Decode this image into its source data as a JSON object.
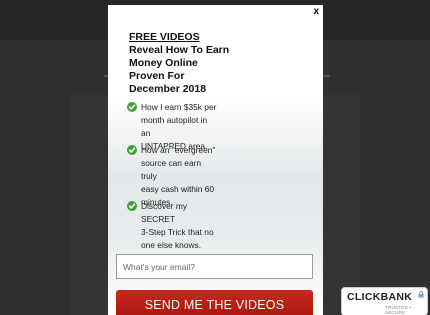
{
  "modal": {
    "close_label": "x",
    "headline_underlined": "FREE VIDEOS",
    "headline_lines": [
      "Reveal How To Earn",
      "Money Online",
      "Proven For",
      "December 2018"
    ],
    "bullets": [
      {
        "lines": [
          "How I earn $35k per",
          "month autopilot in an",
          "UNTAPPED area."
        ]
      },
      {
        "lines": [
          "How an \"evergreen\"",
          "source can earn truly",
          "easy cash within 60",
          "minutes."
        ]
      },
      {
        "lines": [
          "Discover my SECRET",
          "3-Step Trick that no",
          "one else knows."
        ]
      }
    ],
    "email_placeholder": "What's your email?",
    "cta_label": "SEND ME THE VIDEOS"
  },
  "badge": {
    "brand": "CLICKBANK",
    "tagline": "TRUSTED • SECURE"
  },
  "colors": {
    "cta": "#b81d12",
    "check": "#43a33b",
    "background": "#2e2e2e"
  },
  "icons": {
    "bullet": "check-icon",
    "close": "close-icon",
    "badge": "lock-icon"
  }
}
